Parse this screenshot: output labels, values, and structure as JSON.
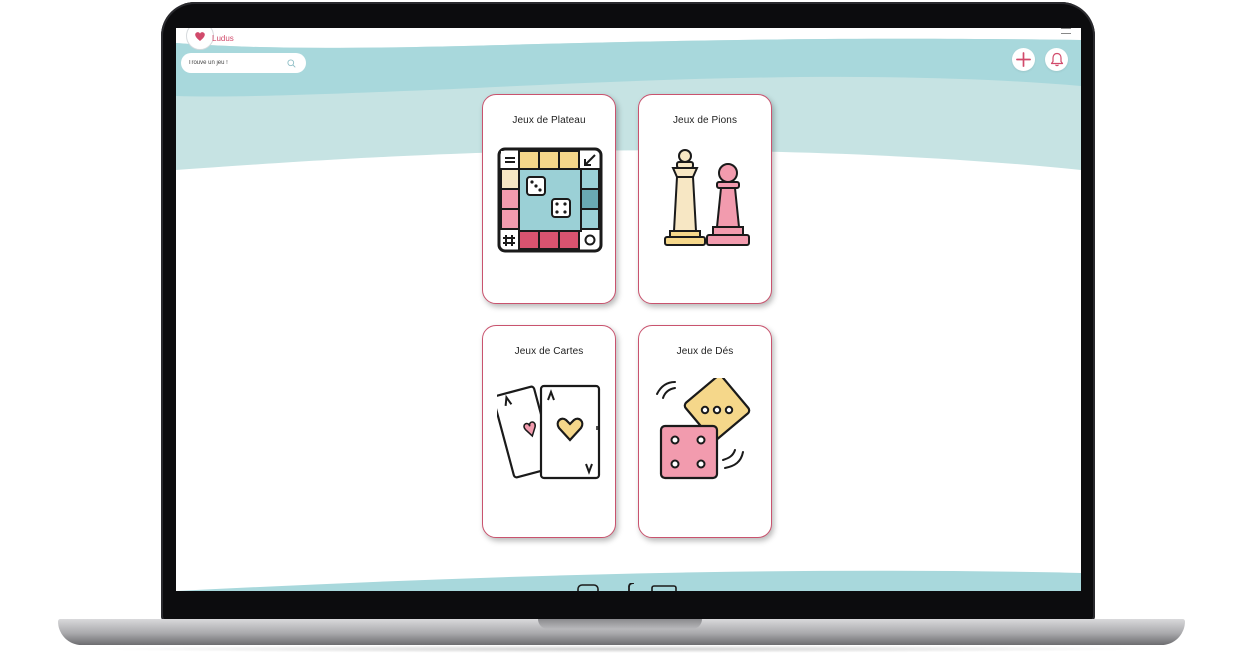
{
  "app": {
    "brand": "Ludus"
  },
  "search": {
    "placeholder": "Trouve un jeu !"
  },
  "header": {
    "add_icon": "plus-icon",
    "notify_icon": "bell-icon",
    "menu_icon": "hamburger-icon"
  },
  "categories": [
    {
      "label": "Jeux de Plateau",
      "icon": "board-game-icon"
    },
    {
      "label": "Jeux de Pions",
      "icon": "chess-pieces-icon"
    },
    {
      "label": "Jeux de Cartes",
      "icon": "playing-cards-icon"
    },
    {
      "label": "Jeux de Dés",
      "icon": "dice-icon"
    }
  ],
  "colors": {
    "accent": "#d14a6b",
    "card_border": "#c9536e",
    "wave_light": "#c6e3e3",
    "wave_dark": "#a8d8dc",
    "icon_yellow": "#f5d78a",
    "icon_pink": "#f29bae",
    "icon_red": "#d9536f",
    "icon_teal": "#9bd0d6",
    "icon_cream": "#f7e7c4"
  }
}
